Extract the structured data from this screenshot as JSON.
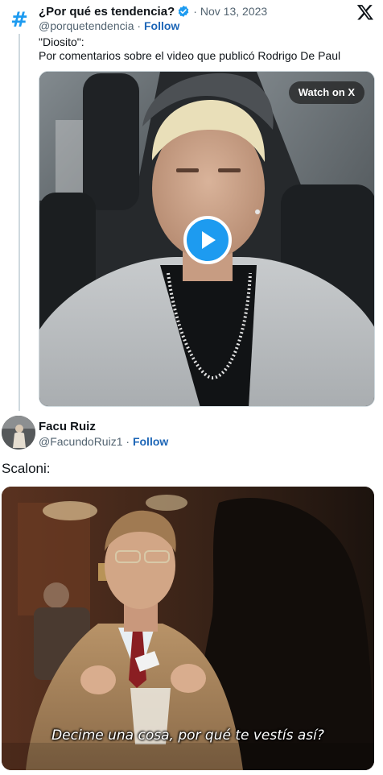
{
  "quoted_tweet": {
    "author_name": "¿Por qué es tendencia?",
    "verified": true,
    "separator": "·",
    "date": "Nov 13, 2023",
    "handle": "@porquetendencia",
    "follow_label": "Follow",
    "text_line1": "\"Diosito\":",
    "text_line2": "Por comentarios sobre el video que publicó Rodrigo De Paul",
    "video": {
      "watch_label": "Watch on X",
      "play_icon": "play-icon"
    }
  },
  "main_tweet": {
    "author_name": "Facu Ruiz",
    "handle": "@FacundoRuiz1",
    "separator": "·",
    "follow_label": "Follow",
    "text": "Scaloni:",
    "image_caption": "Decime una cosa, por qué te vestís así?"
  },
  "icons": {
    "platform": "x-logo-icon",
    "avatar_quoted": "hashtag-icon",
    "verified": "verified-badge-icon"
  },
  "colors": {
    "accent": "#1d9bf0",
    "follow": "#1d66b7",
    "secondary_text": "#536471",
    "border": "#cfd9de"
  }
}
